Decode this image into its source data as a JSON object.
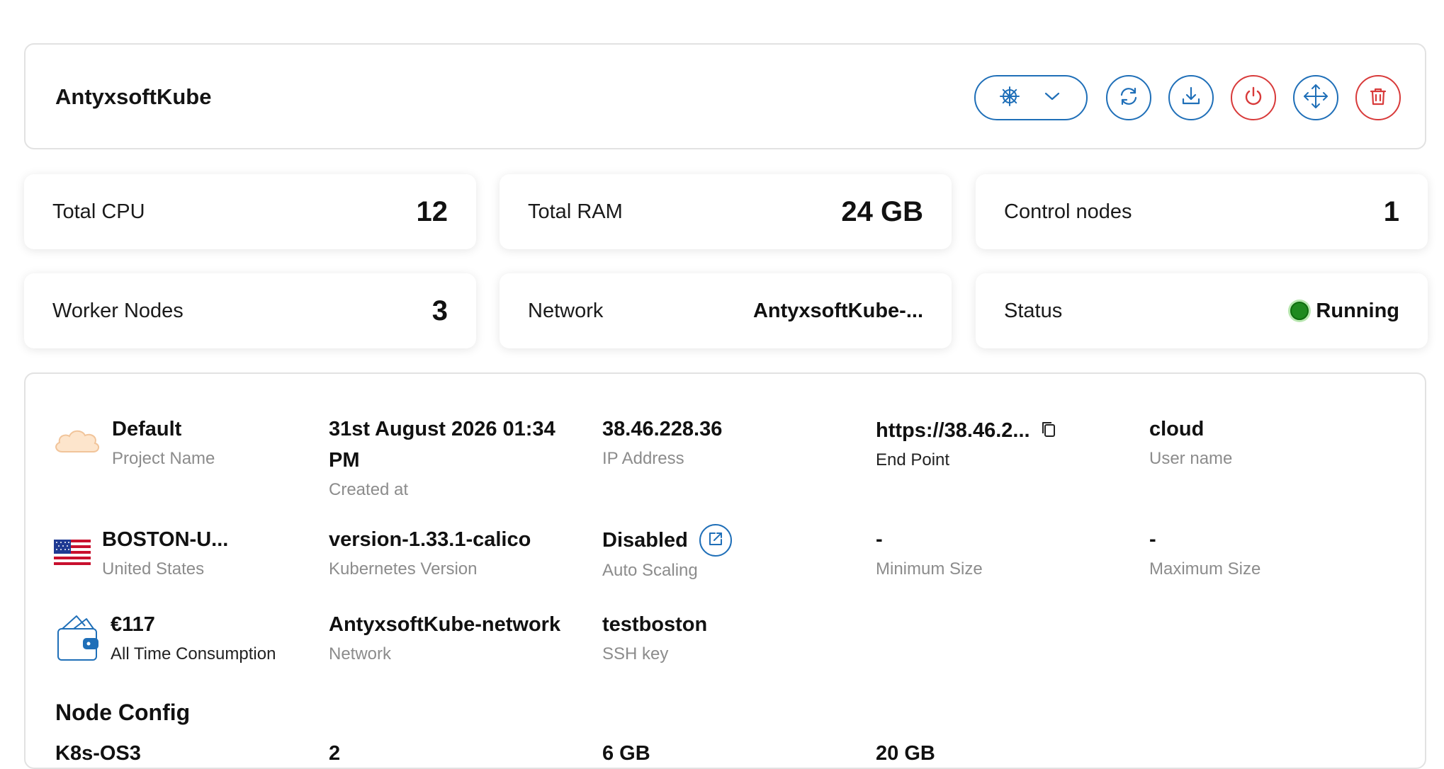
{
  "header": {
    "title": "AntyxsoftKube",
    "actions": {
      "kube_menu": "kubernetes-menu",
      "refresh": "refresh",
      "download": "download",
      "power": "power",
      "resize": "resize",
      "delete": "delete"
    }
  },
  "stats": {
    "total_cpu": {
      "label": "Total CPU",
      "value": "12"
    },
    "total_ram": {
      "label": "Total RAM",
      "value": "24 GB"
    },
    "control_nodes": {
      "label": "Control nodes",
      "value": "1"
    },
    "worker_nodes": {
      "label": "Worker Nodes",
      "value": "3"
    },
    "network": {
      "label": "Network",
      "value": "AntyxsoftKube-..."
    },
    "status": {
      "label": "Status",
      "value": "Running",
      "color": "#1f8a1f"
    }
  },
  "details": {
    "project": {
      "value": "Default",
      "label": "Project Name"
    },
    "created": {
      "value_line1": "31st August 2026 01:34",
      "value_line2": "PM",
      "label": "Created at"
    },
    "ip": {
      "value": "38.46.228.36",
      "label": "IP Address"
    },
    "endpoint": {
      "value": "https://38.46.2...",
      "label": "End Point"
    },
    "username": {
      "value": "cloud",
      "label": "User name"
    },
    "region": {
      "value": "BOSTON-U...",
      "label": "United States"
    },
    "k8s_version": {
      "value": "version-1.33.1-calico",
      "label": "Kubernetes Version"
    },
    "autoscaling": {
      "value": "Disabled",
      "label": "Auto Scaling"
    },
    "min_size": {
      "value": "-",
      "label": "Minimum Size"
    },
    "max_size": {
      "value": "-",
      "label": "Maximum Size"
    },
    "consumption": {
      "value": "€117",
      "label": "All Time Consumption"
    },
    "network": {
      "value": "AntyxsoftKube-network",
      "label": "Network"
    },
    "ssh": {
      "value": "testboston",
      "label": "SSH key"
    }
  },
  "node_config": {
    "title": "Node Config",
    "row_partial": [
      "K8s-OS3",
      "2",
      "6 GB",
      "20 GB"
    ]
  },
  "colors": {
    "primary": "#1f6fb8",
    "danger": "#d83a3a",
    "running": "#1f8a1f"
  }
}
